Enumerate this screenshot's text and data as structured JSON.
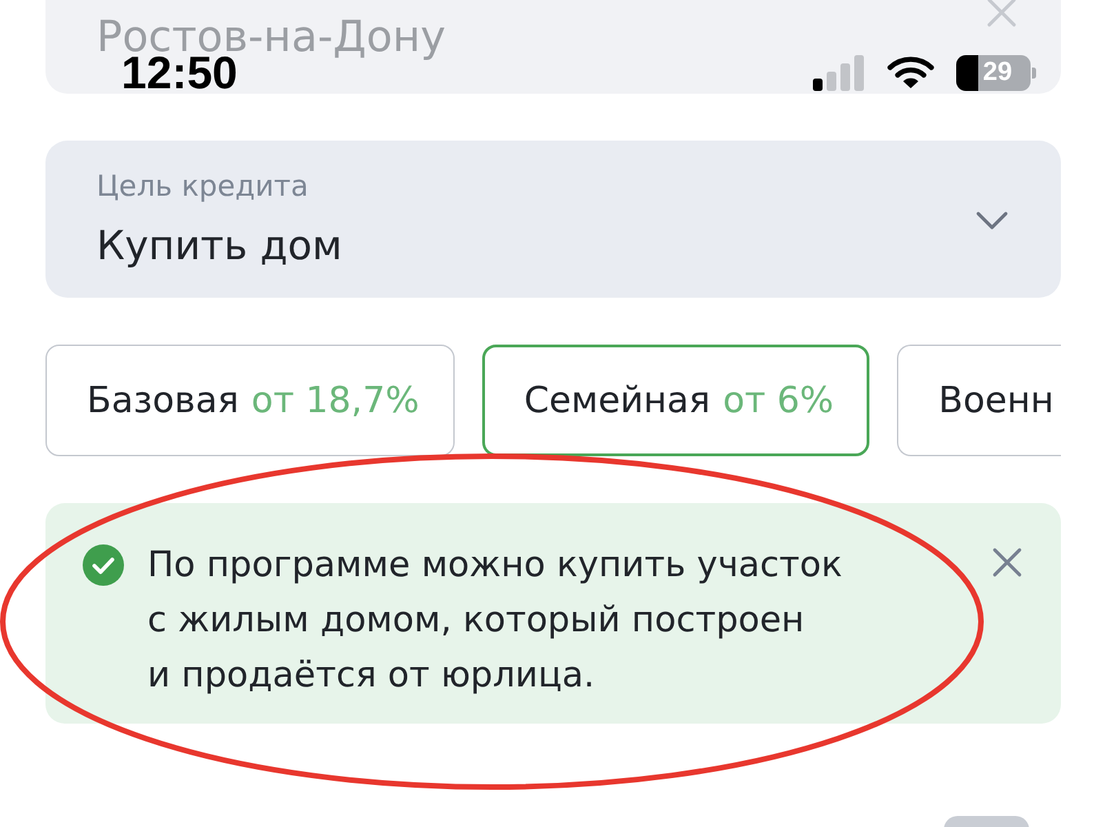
{
  "status_bar": {
    "time": "12:50",
    "battery": "29"
  },
  "city_field": {
    "value": "Ростов-на-Дону"
  },
  "loan_purpose": {
    "label": "Цель кредита",
    "value": "Купить дом"
  },
  "programs": [
    {
      "name": "Базовая",
      "rate": "от 18,7%",
      "selected": false
    },
    {
      "name": "Семейная",
      "rate": "от 6%",
      "selected": true
    },
    {
      "name": "Военн",
      "selected": false
    }
  ],
  "notice": {
    "lines": [
      "По программе можно купить участок",
      "с жилым домом, который построен",
      "и продаётся от юрлица."
    ]
  }
}
